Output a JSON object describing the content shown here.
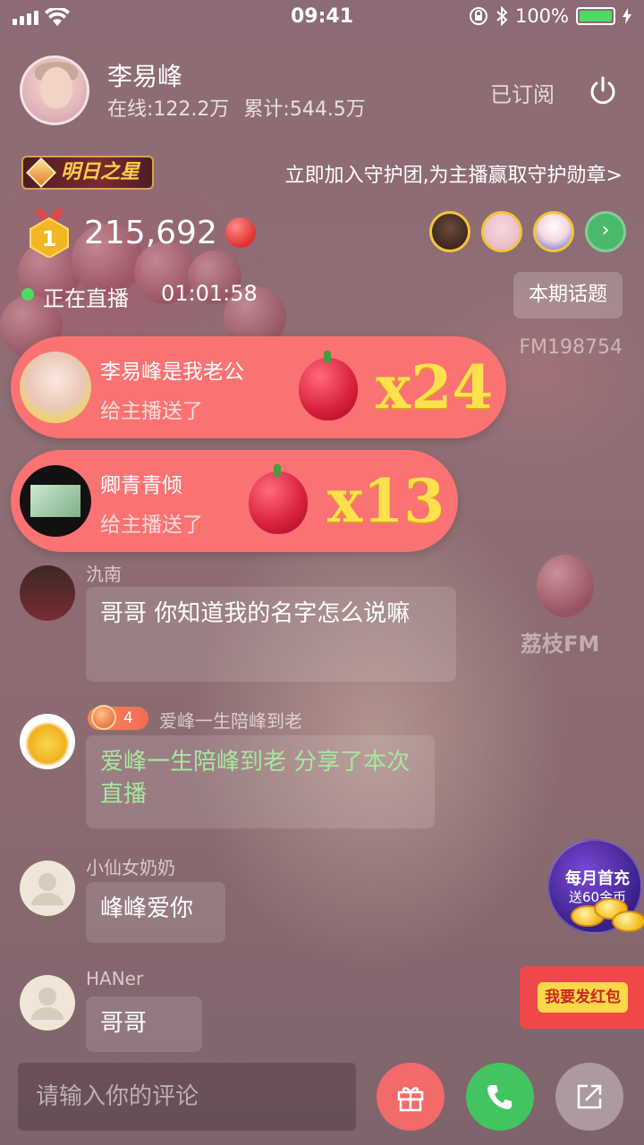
{
  "status_bar": {
    "time": "09:41",
    "battery": "100%"
  },
  "host": {
    "name": "李易峰",
    "online": "在线:122.2万",
    "total": "累计:544.5万",
    "subscribe_label": "已订阅"
  },
  "banner": {
    "star_label": "明日之星",
    "guard_text": "立即加入守护团,为主播赢取守护勋章>"
  },
  "rank": {
    "medal_number": "1",
    "score": "215,692"
  },
  "live": {
    "label": "正在直播",
    "duration": "01:01:58",
    "topic_button": "本期话题",
    "fm_id": "FM198754"
  },
  "gifts": [
    {
      "sender": "李易峰是我老公",
      "action": "给主播送了",
      "count": "x24"
    },
    {
      "sender": "卿青青倾",
      "action": "给主播送了",
      "count": "x13"
    }
  ],
  "comments": [
    {
      "name": "氿南",
      "text": "哥哥 你知道我的名字怎么说嘛"
    },
    {
      "name": "爱峰一生陪峰到老",
      "level": "4",
      "text": "爱峰一生陪峰到老  分享了本次直播"
    },
    {
      "name": "小仙女奶奶",
      "text": "峰峰爱你"
    },
    {
      "name": "HANer",
      "text": "哥哥"
    }
  ],
  "promo": {
    "line1": "每月首充",
    "line2": "送60金币"
  },
  "red_packet": {
    "label": "我要发红包"
  },
  "watermark": "荔枝FM",
  "input": {
    "placeholder": "请输入你的评论"
  },
  "colors": {
    "gift_banner": "#fb7272",
    "gift_count": "#ffe14d",
    "live_dot": "#4cd964",
    "call_button": "#42c460",
    "gift_button": "#f26a6a"
  },
  "icons": [
    "signal-icon",
    "wifi-icon",
    "lock-rotation-icon",
    "bluetooth-icon",
    "battery-icon",
    "power-icon",
    "medal-icon",
    "lychee-icon",
    "chevron-right-icon",
    "gift-icon",
    "phone-icon",
    "share-icon"
  ]
}
